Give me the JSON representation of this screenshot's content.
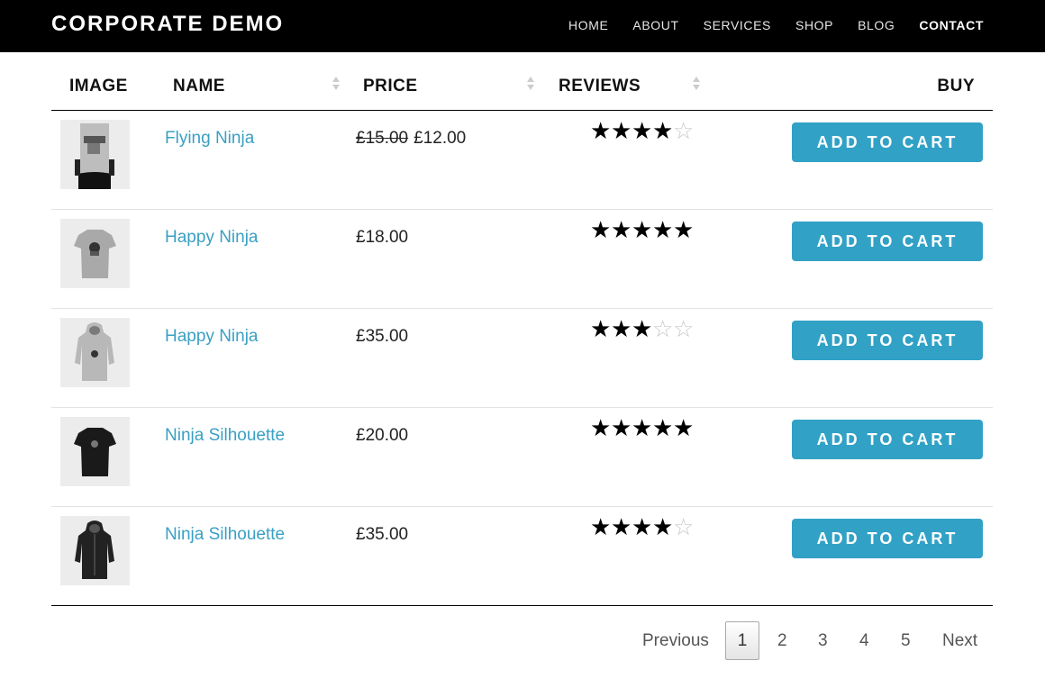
{
  "brand": "CORPORATE DEMO",
  "nav": [
    {
      "label": "HOME",
      "active": false
    },
    {
      "label": "ABOUT",
      "active": false
    },
    {
      "label": "SERVICES",
      "active": false
    },
    {
      "label": "SHOP",
      "active": false
    },
    {
      "label": "BLOG",
      "active": false
    },
    {
      "label": "CONTACT",
      "active": true
    }
  ],
  "table": {
    "headers": {
      "image": "IMAGE",
      "name": "NAME",
      "price": "PRICE",
      "reviews": "REVIEWS",
      "buy": "BUY"
    },
    "button_label": "ADD TO CART",
    "rows": [
      {
        "name": "Flying Ninja",
        "old_price": "£15.00",
        "price": "£12.00",
        "rating": 4,
        "image": "poster"
      },
      {
        "name": "Happy Ninja",
        "old_price": "",
        "price": "£18.00",
        "rating": 5,
        "image": "tshirt-grey"
      },
      {
        "name": "Happy Ninja",
        "old_price": "",
        "price": "£35.00",
        "rating": 3,
        "image": "hoodie-grey"
      },
      {
        "name": "Ninja Silhouette",
        "old_price": "",
        "price": "£20.00",
        "rating": 5,
        "image": "tshirt-black"
      },
      {
        "name": "Ninja Silhouette",
        "old_price": "",
        "price": "£35.00",
        "rating": 4,
        "image": "hoodie-black"
      }
    ]
  },
  "pagination": {
    "previous": "Previous",
    "pages": [
      "1",
      "2",
      "3",
      "4",
      "5"
    ],
    "current": "1",
    "next": "Next"
  },
  "colors": {
    "accent": "#31a1c6",
    "link": "#3aa0c3",
    "topbar": "#000000"
  }
}
